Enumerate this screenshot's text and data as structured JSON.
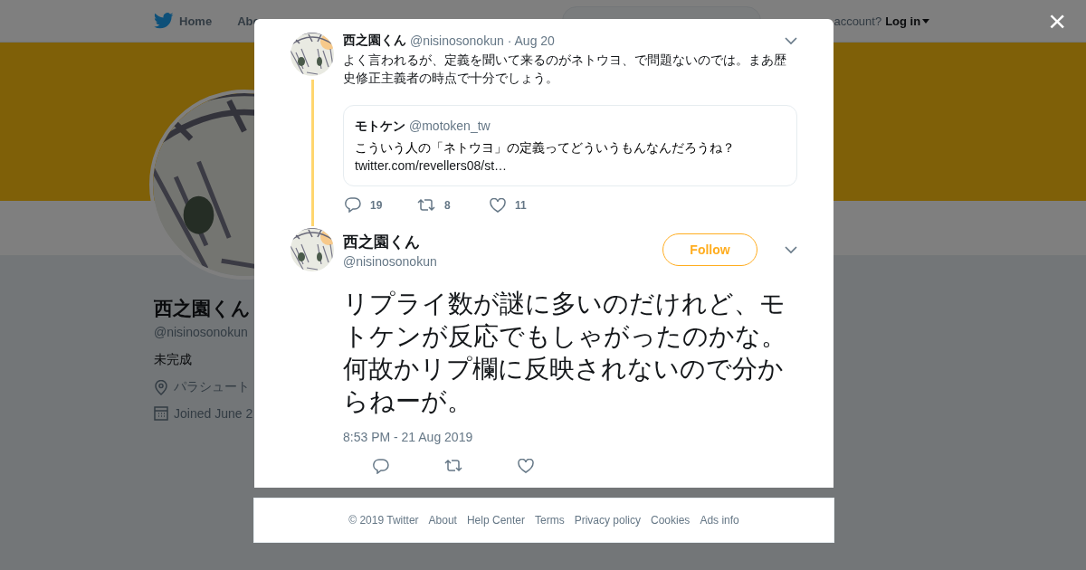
{
  "nav": {
    "items": [
      "Home",
      "Abo"
    ],
    "account_text": "account?",
    "login": "Log in"
  },
  "profile": {
    "name": "西之園くん",
    "handle": "@nisinosonokun",
    "bio": "未完成",
    "location": "パラシュート",
    "joined": "Joined June 2"
  },
  "modal": {
    "close": "×",
    "parent_tweet": {
      "name": "西之園くん",
      "handle": "@nisinosonokun",
      "date": "· Aug 20",
      "text": "よく言われるが、定義を聞いて来るのがネトウヨ、で問題ないのでは。まあ歴史修正主義者の時点で十分でしょう。",
      "quote": {
        "name": "モトケン",
        "handle": "@motoken_tw",
        "text": "こういう人の「ネトウヨ」の定義ってどういうもんなんだろうね？",
        "link": "twitter.com/revellers08/st…"
      },
      "replies": "19",
      "retweets": "8",
      "likes": "11"
    },
    "tweet": {
      "name": "西之園くん",
      "handle": "@nisinosonokun",
      "follow": "Follow",
      "text": "リプライ数が謎に多いのだけれど、モトケンが反応でもしゃがったのかな。何故かリプ欄に反映されないので分からねーが。",
      "timestamp": "8:53 PM - 21 Aug 2019"
    }
  },
  "footer": [
    "© 2019 Twitter",
    "About",
    "Help Center",
    "Terms",
    "Privacy policy",
    "Cookies",
    "Ads info"
  ]
}
